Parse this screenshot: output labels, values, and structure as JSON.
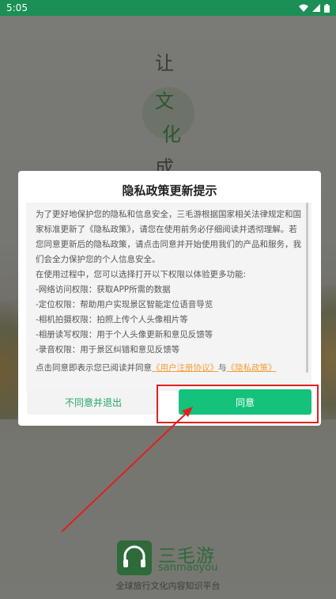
{
  "status_bar": {
    "time": "5:05",
    "icons": [
      "wifi-icon",
      "signal-icon",
      "battery-icon"
    ]
  },
  "splash": {
    "chars": [
      "让",
      "文",
      "化",
      "成"
    ]
  },
  "dialog": {
    "title": "隐私政策更新提示",
    "paragraphs": [
      "为了更好地保护您的隐私和信息安全，三毛游根据国家相关法律规定和国家标准更新了《隐私政策》，请您在使用前务必仔细阅读并透彻理解。若您同意更新后的隐私政策，请点击同意并开始使用我们的产品和服务，我们会全力保护您的个人信息安全。",
      "在使用过程中，您可以选择打开以下权限以体验更多功能:",
      "-网络访问权限：获取APP所需的数据",
      "-定位权限：帮助用户实现景区智能定位语音导览",
      "-相机拍摄权限：拍照上传个人头像相片等",
      "-相册读写权限：用于个人头像更新和意见反馈等",
      "-录音权限：用于景区纠错和意见反馈等"
    ],
    "consent_prefix": "点击同意即表示您已阅读并同意",
    "user_agreement_link": "《用户注册协议》",
    "consent_and": "与",
    "privacy_link": "《隐私政策》",
    "disagree_label": "不同意并退出",
    "agree_label": "同意"
  },
  "brand": {
    "name_cn": "三毛游",
    "name_en": "sanmaoyou",
    "tagline": "全球旅行文化内容知识平台"
  },
  "colors": {
    "status_bar": "#1b8f55",
    "accent_green": "#14c27b",
    "link_orange": "#f1a03a",
    "annotation_red": "#e02020"
  }
}
